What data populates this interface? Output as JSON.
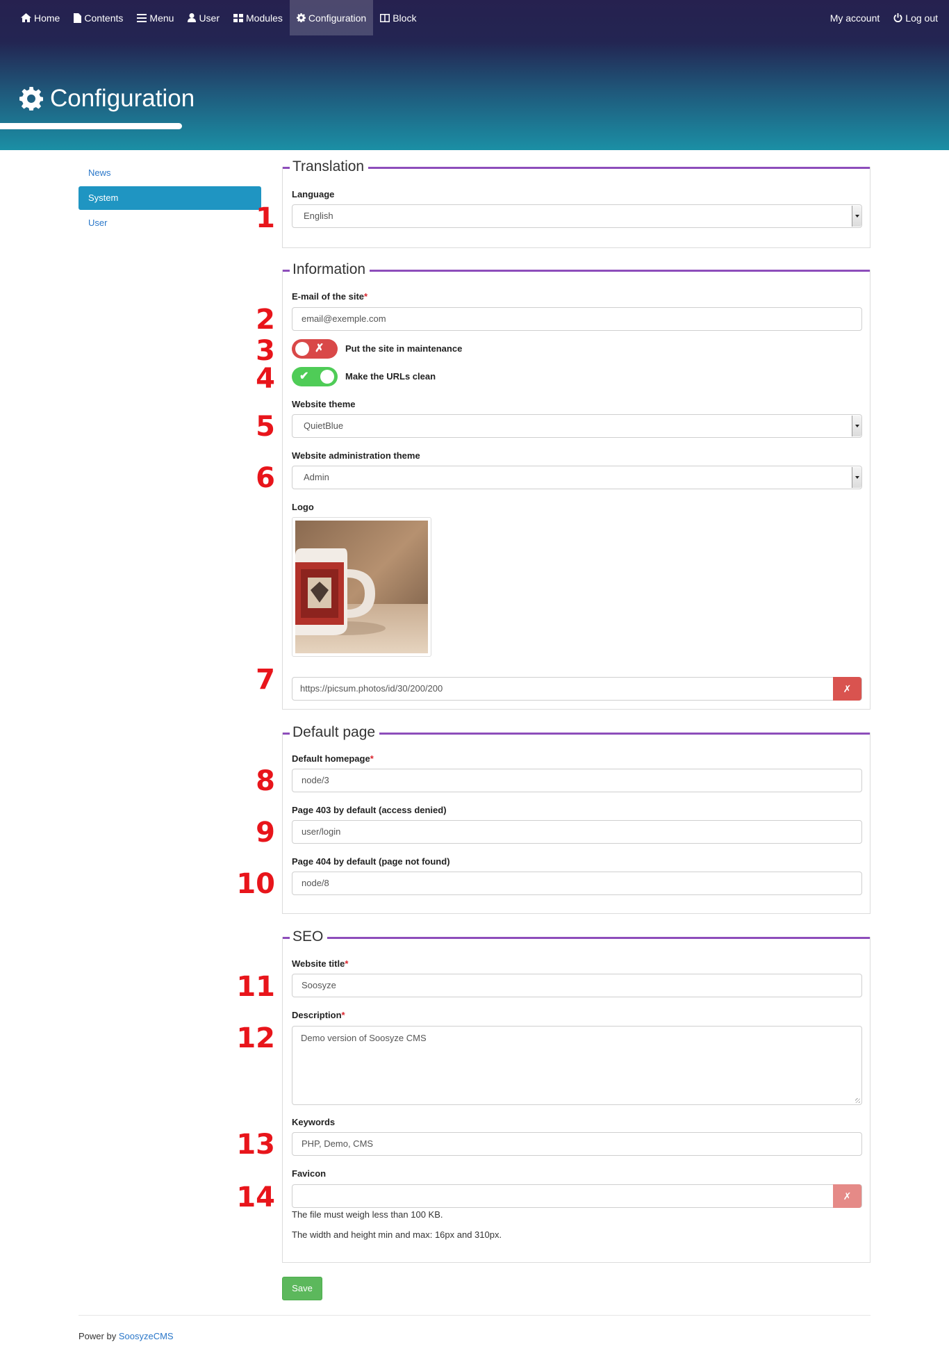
{
  "nav": {
    "left": [
      {
        "label": "Home",
        "icon": "home-icon"
      },
      {
        "label": "Contents",
        "icon": "file-icon"
      },
      {
        "label": "Menu",
        "icon": "menu-icon"
      },
      {
        "label": "User",
        "icon": "user-icon"
      },
      {
        "label": "Modules",
        "icon": "modules-icon"
      },
      {
        "label": "Configuration",
        "icon": "gear-icon"
      },
      {
        "label": "Block",
        "icon": "block-icon"
      }
    ],
    "active": "Configuration",
    "right": [
      {
        "label": "My account"
      },
      {
        "label": "Log out",
        "icon": "power-icon"
      }
    ]
  },
  "page": {
    "title": "Configuration"
  },
  "sidebar": {
    "items": [
      {
        "label": "News"
      },
      {
        "label": "System"
      },
      {
        "label": "User"
      }
    ],
    "active": "System"
  },
  "annotations": [
    "1",
    "2",
    "3",
    "4",
    "5",
    "6",
    "7",
    "8",
    "9",
    "10",
    "11",
    "12",
    "13",
    "14"
  ],
  "translation": {
    "legend": "Translation",
    "language_label": "Language",
    "language_value": "English"
  },
  "information": {
    "legend": "Information",
    "email_label": "E-mail of the site",
    "email_required": "*",
    "email_value": "email@exemple.com",
    "maintenance_label": "Put the site in maintenance",
    "maintenance_state": "off",
    "maintenance_mark": "✗",
    "clean_urls_label": "Make the URLs clean",
    "clean_urls_state": "on",
    "clean_urls_mark": "✔",
    "theme_label": "Website theme",
    "theme_value": "QuietBlue",
    "admin_theme_label": "Website administration theme",
    "admin_theme_value": "Admin",
    "logo_label": "Logo",
    "logo_url": "https://picsum.photos/id/30/200/200",
    "clear_mark": "✗"
  },
  "default_page": {
    "legend": "Default page",
    "homepage_label": "Default homepage",
    "homepage_required": "*",
    "homepage_value": "node/3",
    "page403_label": "Page 403 by default (access denied)",
    "page403_value": "user/login",
    "page404_label": "Page 404 by default (page not found)",
    "page404_value": "node/8"
  },
  "seo": {
    "legend": "SEO",
    "title_label": "Website title",
    "title_required": "*",
    "title_value": "Soosyze",
    "description_label": "Description",
    "description_required": "*",
    "description_value": "Demo version of Soosyze CMS",
    "keywords_label": "Keywords",
    "keywords_value": "PHP, Demo, CMS",
    "favicon_label": "Favicon",
    "favicon_value": "",
    "clear_mark": "✗",
    "help_1": "The file must weigh less than 100 KB.",
    "help_2": "The width and height min and max: 16px and 310px."
  },
  "save_label": "Save",
  "footer": {
    "prefix": "Power by",
    "link": "SoosyzeCMS"
  },
  "colors": {
    "accent": "#8d4dbb",
    "active": "#1f95c2",
    "danger": "#d9534f",
    "success": "#5cb85c",
    "annotation": "#e8151b"
  }
}
